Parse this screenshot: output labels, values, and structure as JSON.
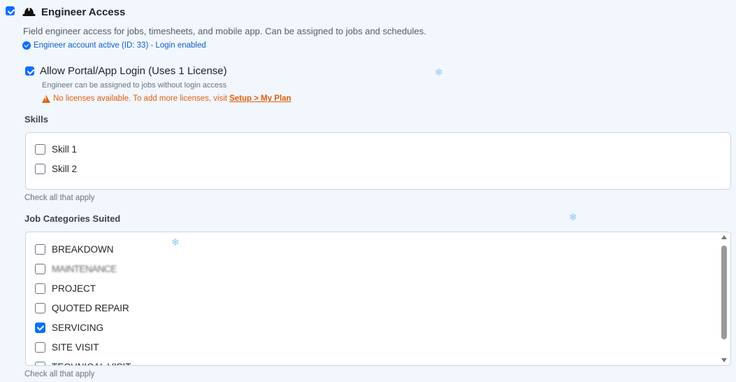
{
  "header": {
    "checked": true,
    "title": "Engineer Access",
    "description": "Field engineer access for jobs, timesheets, and mobile app. Can be assigned to jobs and schedules.",
    "status": "Engineer account active (ID: 33) - Login enabled"
  },
  "portal": {
    "checked": true,
    "label": "Allow Portal/App Login (Uses 1 License)",
    "help": "Engineer can be assigned to jobs without login access",
    "warning": "No licenses available. To add more licenses, visit",
    "warning_link": "Setup > My Plan"
  },
  "skills": {
    "label": "Skills",
    "help": "Check all that apply",
    "options": [
      {
        "label": "Skill 1",
        "checked": false
      },
      {
        "label": "Skill 2",
        "checked": false
      }
    ]
  },
  "jobs": {
    "label": "Job Categories Suited",
    "help": "Check all that apply",
    "options": [
      {
        "label": "BREAKDOWN",
        "checked": false
      },
      {
        "label": "MAINTENANCE",
        "checked": false
      },
      {
        "label": "PROJECT",
        "checked": false
      },
      {
        "label": "QUOTED REPAIR",
        "checked": false
      },
      {
        "label": "SERVICING",
        "checked": true
      },
      {
        "label": "SITE VISIT",
        "checked": false
      },
      {
        "label": "TECHNICAL VISIT",
        "checked": false
      }
    ]
  },
  "colors": {
    "accent": "#0d6efd",
    "warning": "#e35d0f",
    "background": "#f2f6fd"
  },
  "icons": {
    "header": "hard-hat-icon",
    "status": "check-circle-icon",
    "warning": "warning-triangle-icon",
    "decor": "snowflake-icon"
  }
}
